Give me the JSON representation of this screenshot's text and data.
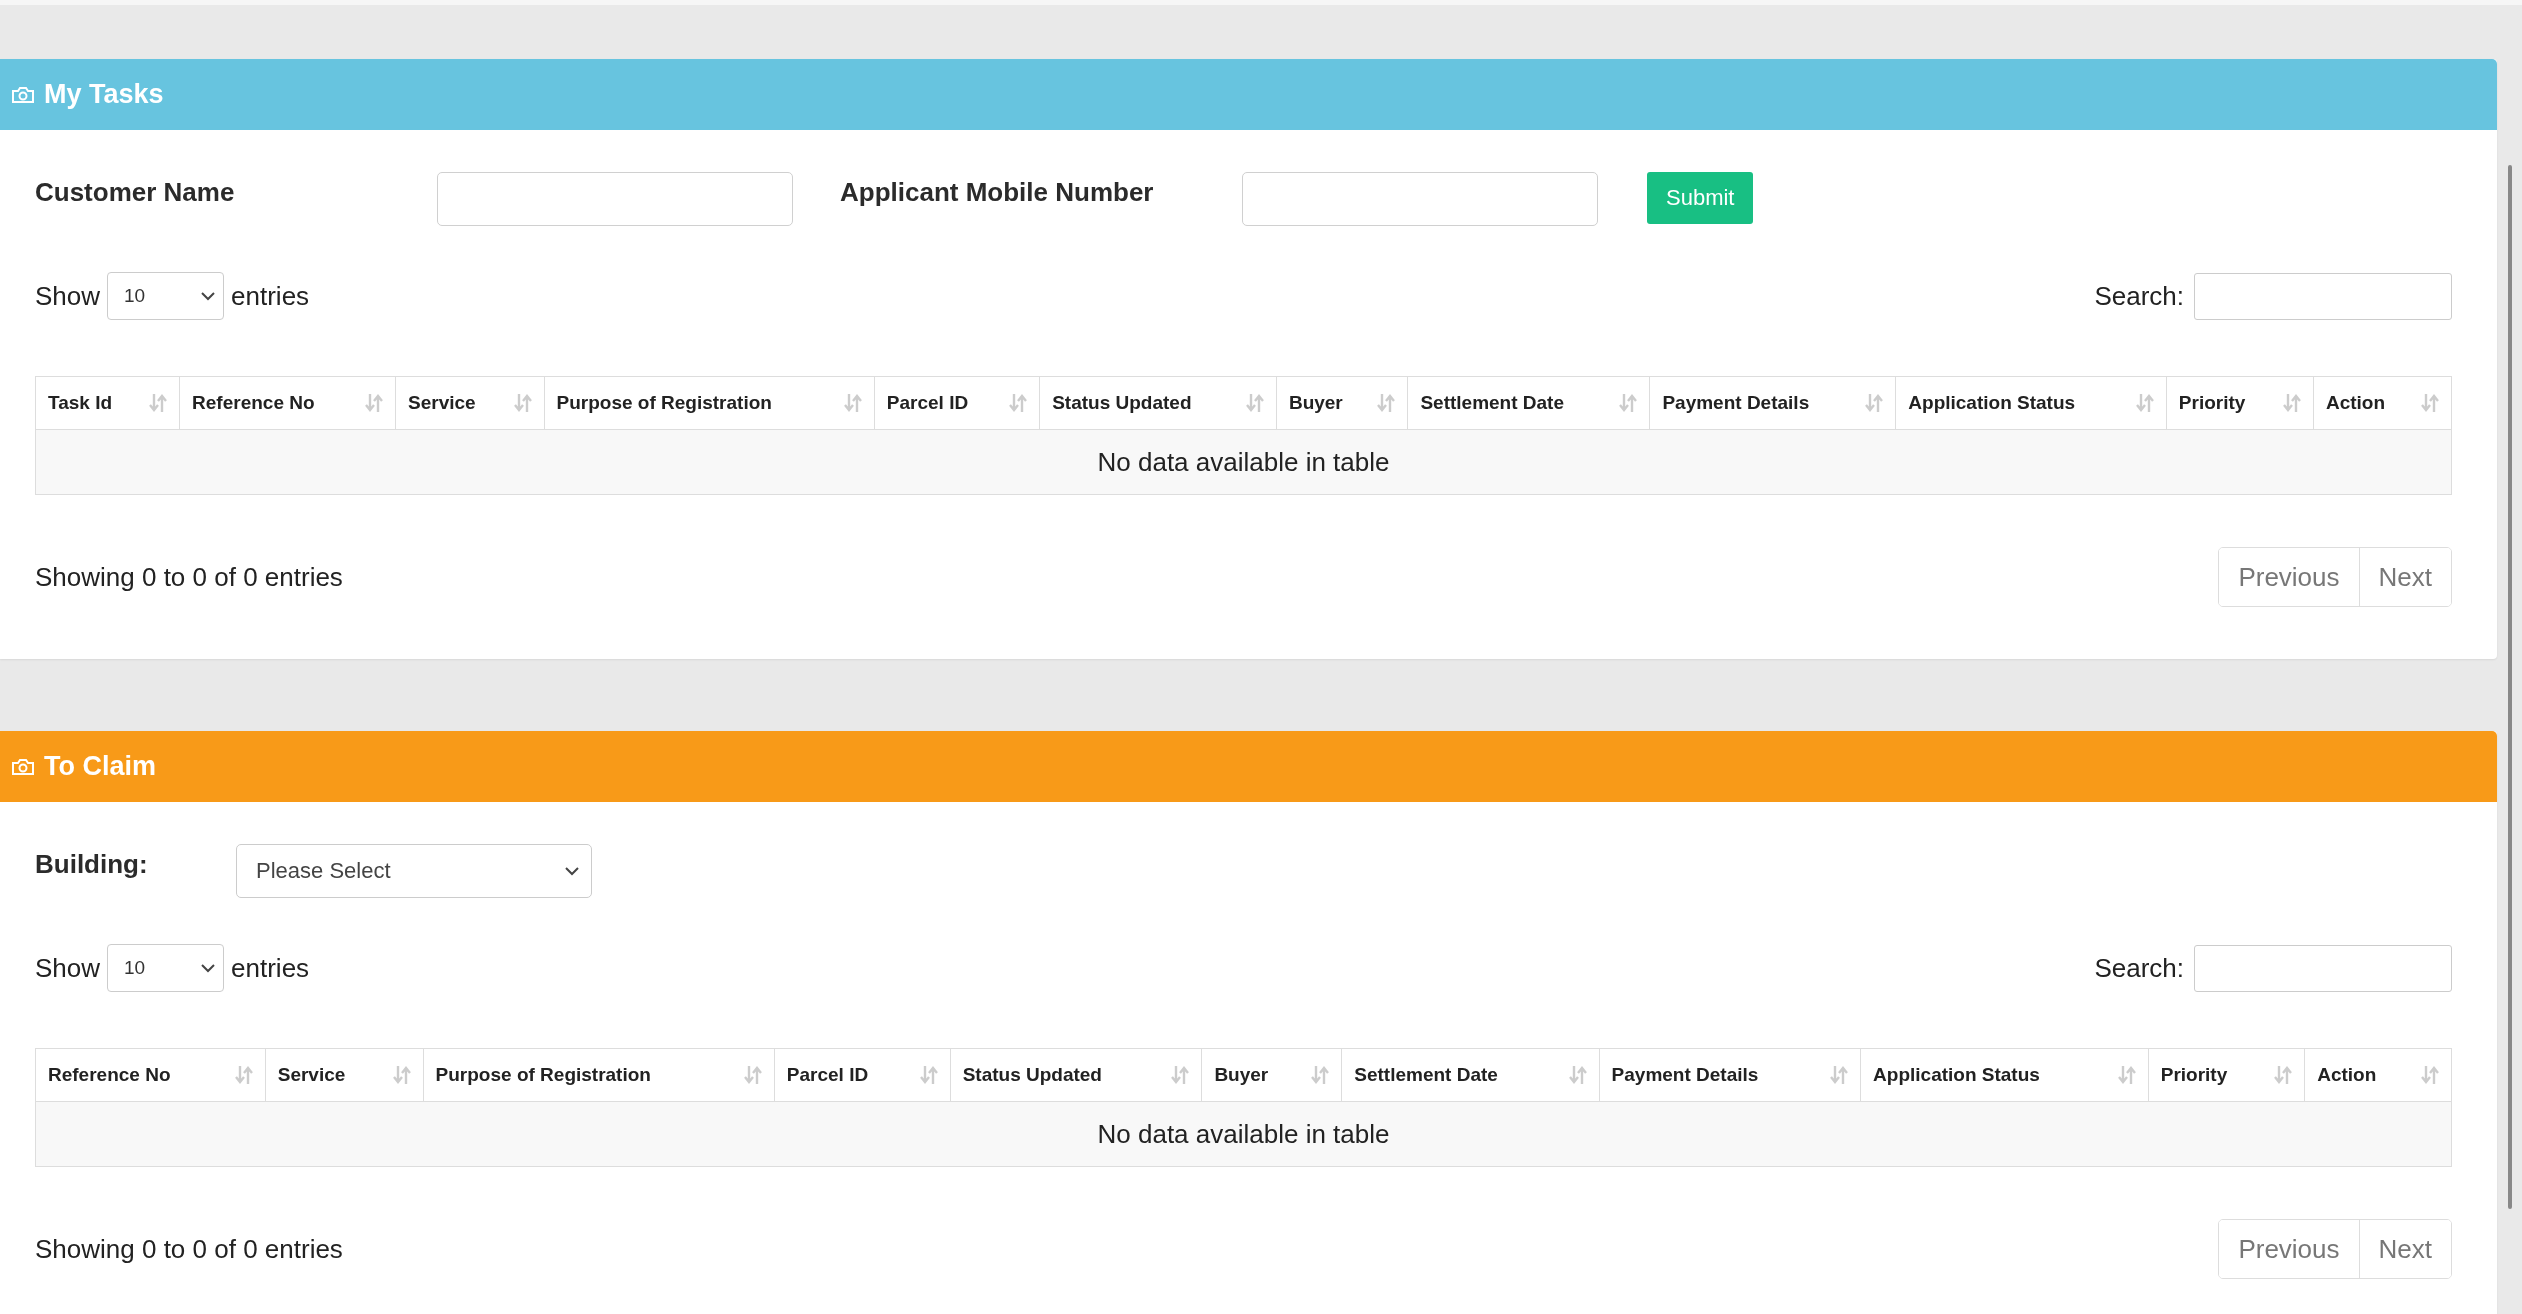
{
  "panels": [
    {
      "kind": "tasks",
      "title": "My Tasks",
      "color": "#67c4df",
      "filters": [
        {
          "kind": "input",
          "label": "Customer Name"
        },
        {
          "kind": "input",
          "label": "Applicant Mobile Number"
        },
        {
          "kind": "button",
          "label": "Submit"
        }
      ],
      "length": {
        "before": "Show",
        "value": "10",
        "after": "entries"
      },
      "search": {
        "label": "Search:"
      },
      "table": {
        "columns": [
          "Task Id",
          "Reference No",
          "Service",
          "Purpose of Registration",
          "Parcel ID",
          "Status Updated",
          "Buyer",
          "Settlement Date",
          "Payment Details",
          "Application Status",
          "Priority",
          "Action"
        ],
        "empty": "No data available in table"
      },
      "info": "Showing 0 to 0 of 0 entries",
      "pagination": [
        "Previous",
        "Next"
      ]
    },
    {
      "kind": "claim",
      "title": "To Claim",
      "color": "#f89a18",
      "filters": [
        {
          "kind": "select",
          "label": "Building:",
          "value": "Please Select"
        }
      ],
      "length": {
        "before": "Show",
        "value": "10",
        "after": "entries"
      },
      "search": {
        "label": "Search:"
      },
      "table": {
        "columns": [
          "Reference No",
          "Service",
          "Purpose of Registration",
          "Parcel ID",
          "Status Updated",
          "Buyer",
          "Settlement Date",
          "Payment Details",
          "Application Status",
          "Priority",
          "Action"
        ],
        "empty": "No data available in table"
      },
      "info": "Showing 0 to 0 of 0 entries",
      "pagination": [
        "Previous",
        "Next"
      ]
    }
  ]
}
